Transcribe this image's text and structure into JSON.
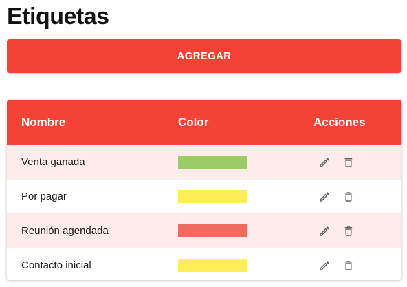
{
  "title": "Etiquetas",
  "add_button_label": "AGREGAR",
  "table": {
    "headers": {
      "name": "Nombre",
      "color": "Color",
      "actions": "Acciones"
    },
    "rows": [
      {
        "name": "Venta ganada",
        "color": "#9ccc65"
      },
      {
        "name": "Por pagar",
        "color": "#ffee58"
      },
      {
        "name": "Reunión agendada",
        "color": "#ef6b5e"
      },
      {
        "name": "Contacto inicial",
        "color": "#ffee58"
      }
    ],
    "action_icons": [
      "pencil-icon",
      "trash-icon"
    ]
  },
  "colors": {
    "primary": "#f44336",
    "row_highlight": "#fdecea",
    "icon": "#616161"
  }
}
